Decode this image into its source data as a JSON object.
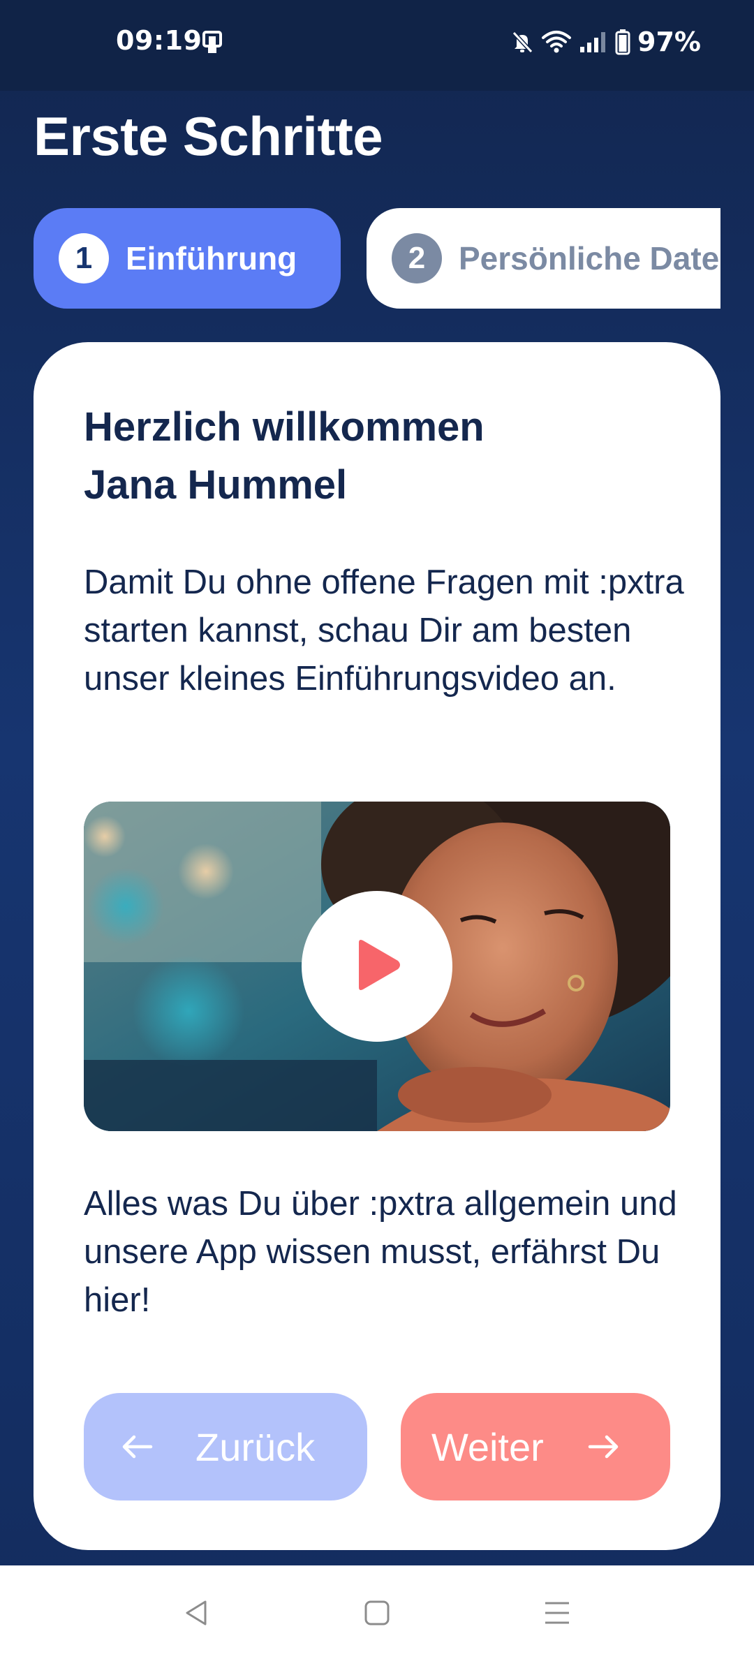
{
  "status_bar": {
    "time": "09:19",
    "battery": "97%",
    "icons": [
      "phone-notification-icon",
      "mute-icon",
      "wifi-icon",
      "signal-icon",
      "battery-icon"
    ]
  },
  "page_title": "Erste Schritte",
  "steps": [
    {
      "number": "1",
      "label": "Einführung",
      "active": true
    },
    {
      "number": "2",
      "label": "Persönliche Daten",
      "active": false
    }
  ],
  "card": {
    "heading_line1": "Herzlich willkommen",
    "heading_line2": "Jana Hummel",
    "intro": "Damit Du ohne offene Fragen mit :pxtra starten kannst, schau Dir am besten unser kleines Einführungsvideo an.",
    "video": {
      "play_icon": "play-icon"
    },
    "outro": "Alles was Du über :pxtra allgemein und unsere App wissen musst, erfährst Du hier!",
    "back_label": "Zurück",
    "next_label": "Weiter"
  },
  "colors": {
    "background": "#173570",
    "step_active": "#5b7cf5",
    "heading_text": "#14274e",
    "back_button": "#b3c2fb",
    "next_button": "#fd8b87",
    "play_accent": "#f7656a"
  },
  "nav_bar": {
    "icons": [
      "back-icon",
      "home-icon",
      "menu-icon"
    ]
  }
}
